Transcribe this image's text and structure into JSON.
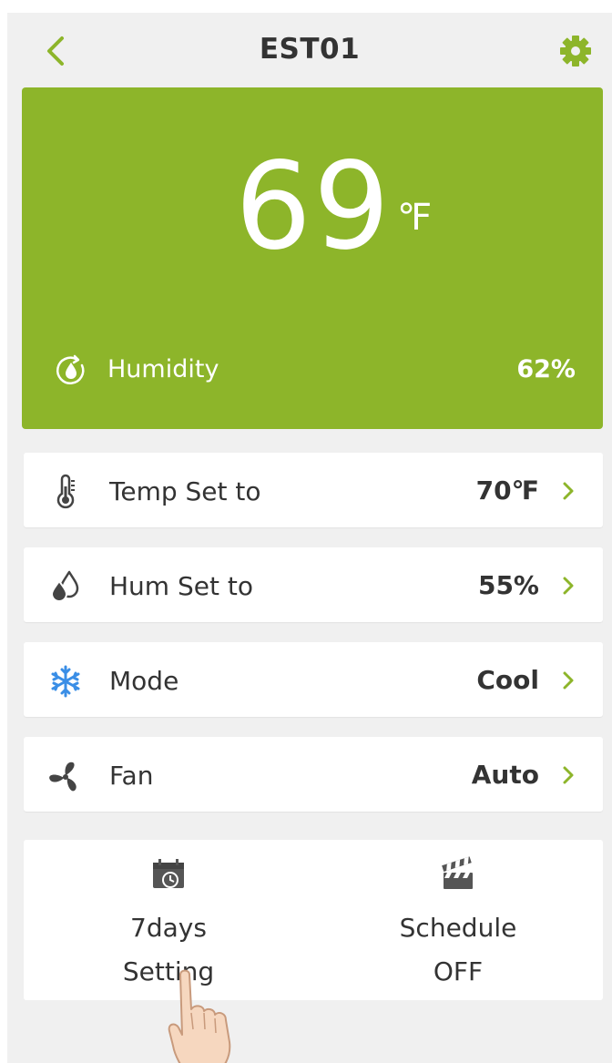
{
  "header": {
    "title": "EST01"
  },
  "hero": {
    "temperature": "69",
    "unit": "℉",
    "humidity_label": "Humidity",
    "humidity_value": "62%"
  },
  "rows": [
    {
      "label": "Temp Set to",
      "value": "70℉",
      "icon": "thermometer-icon"
    },
    {
      "label": "Hum Set to",
      "value": "55%",
      "icon": "droplets-icon"
    },
    {
      "label": "Mode",
      "value": "Cool",
      "icon": "snowflake-icon"
    },
    {
      "label": "Fan",
      "value": "Auto",
      "icon": "fan-icon"
    }
  ],
  "tiles": {
    "seven_days": {
      "line1": "7days",
      "line2": "Setting",
      "icon": "calendar-clock-icon"
    },
    "schedule": {
      "line1": "Schedule",
      "line2": "OFF",
      "icon": "clapperboard-icon"
    }
  },
  "colors": {
    "accent": "#8db52a",
    "snowflake": "#3a8ee6",
    "background": "#f0f0f0"
  }
}
